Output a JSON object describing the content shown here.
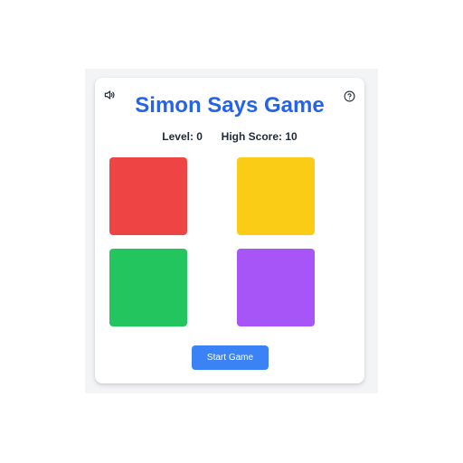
{
  "game": {
    "title": "Simon Says Game",
    "level_label": "Level:",
    "level_value": "0",
    "high_score_label": "High Score:",
    "high_score_value": "10",
    "start_label": "Start Game"
  },
  "icons": {
    "sound": "speaker-icon",
    "help": "help-circle-icon"
  },
  "pads": [
    {
      "name": "red",
      "color": "#ef4444"
    },
    {
      "name": "yellow",
      "color": "#facc15"
    },
    {
      "name": "green",
      "color": "#22c55e"
    },
    {
      "name": "purple",
      "color": "#a855f7"
    }
  ],
  "colors": {
    "title": "#2563eb",
    "start_button": "#3b82f6",
    "background": "#f3f4f6"
  }
}
